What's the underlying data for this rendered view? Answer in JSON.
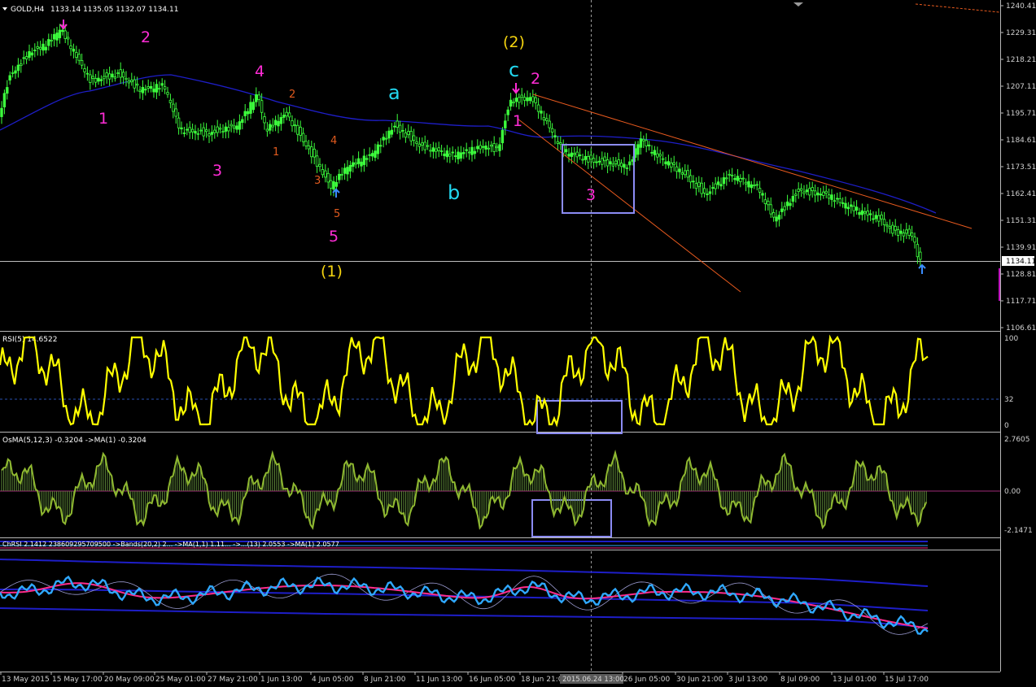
{
  "header": {
    "symbol": "GOLD,H4",
    "ohlc": "1133.14 1135.05 1132.07 1134.11"
  },
  "price_axis": {
    "labels": [
      "1240.41",
      "1229.31",
      "1218.21",
      "1207.11",
      "1195.71",
      "1184.61",
      "1173.51",
      "1162.41",
      "1151.31",
      "1139.91",
      "1128.81",
      "1117.71",
      "1106.61"
    ],
    "current_price": "1134.11"
  },
  "time_axis": {
    "labels": [
      "13 May 2015",
      "15 May 17:00",
      "20 May 09:00",
      "25 May 01:00",
      "27 May 21:00",
      "1 Jun 13:00",
      "4 Jun 05:00",
      "8 Jun 21:00",
      "11 Jun 13:00",
      "16 Jun 05:00",
      "18 Jun 21:00",
      "26 Jun 05:00",
      "30 Jun 21:00",
      "3 Jul 13:00",
      "8 Jul 09:00",
      "13 Jul 01:00",
      "15 Jul 17:00"
    ],
    "crosshair_label": "2015.06.24 13:00"
  },
  "waves": [
    {
      "text": "2",
      "color": "#ff2cd6"
    },
    {
      "text": "1",
      "color": "#ff2cd6"
    },
    {
      "text": "3",
      "color": "#ff2cd6"
    },
    {
      "text": "4",
      "color": "#ff2cd6"
    },
    {
      "text": "5",
      "color": "#ff2cd6"
    },
    {
      "text": "2",
      "color": "#e05a1e"
    },
    {
      "text": "1",
      "color": "#e05a1e"
    },
    {
      "text": "4",
      "color": "#e05a1e"
    },
    {
      "text": "3",
      "color": "#e05a1e"
    },
    {
      "text": "5",
      "color": "#e05a1e"
    },
    {
      "text": "(1)",
      "color": "#f5d40f"
    },
    {
      "text": "a",
      "color": "#22d8f0"
    },
    {
      "text": "b",
      "color": "#22d8f0"
    },
    {
      "text": "(2)",
      "color": "#f5d40f"
    },
    {
      "text": "c",
      "color": "#22d8f0"
    },
    {
      "text": "2",
      "color": "#ff2cd6"
    },
    {
      "text": "1",
      "color": "#ff2cd6"
    },
    {
      "text": "3",
      "color": "#ff2cd6"
    }
  ],
  "rsi": {
    "label": "RSI(5) 14.6522",
    "levels": [
      "100",
      "32",
      "0"
    ]
  },
  "osma": {
    "label": "OsMA(5,12,3) -0.3204  ->MA(1) -0.3204",
    "levels": [
      "2.7605",
      "0.00",
      "-2.1471"
    ]
  },
  "band_indicator": {
    "label": "ChRSI 2.1412 238609295709500  ->Bands(20,2) 2...  ->MA(1,1) 1.11...  ->...(13) 2.0553  ->MA(1) 2.0577"
  },
  "colors": {
    "background": "#000000",
    "candle": "#3dff3d",
    "ma": "#1e1ec8",
    "rsi": "#ffff00",
    "osma_line": "#8fb830",
    "trendline": "#e85a1e",
    "box": "#8c8cf5",
    "band_fast": "#2fa8ff",
    "band_slow": "#ff2c8c"
  },
  "icons": {
    "sell_arrow": "arrow-down-icon",
    "buy_arrow": "arrow-up-icon"
  }
}
